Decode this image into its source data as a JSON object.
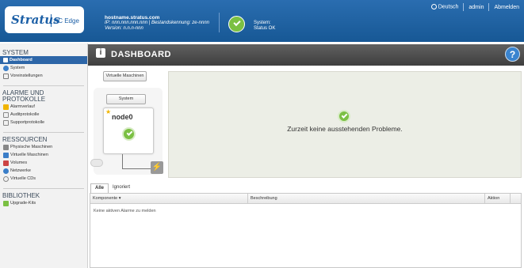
{
  "header": {
    "brand": "Stratus",
    "product": "ztC Edge",
    "hostname": "hostname.stratus.com",
    "ip_line": "IP: nnn.nnn.nnn.nnn | Bestandskennung: ze-nnnn",
    "version_line": "Version: n.n.n-nnn",
    "system_label": "System:",
    "system_status": "Status OK",
    "nav": {
      "language": "Deutsch",
      "user": "admin",
      "logout": "Abmelden"
    },
    "colors": {
      "accent": "#1c5fa3",
      "ok": "#7bc043"
    }
  },
  "sidebar": {
    "sections": [
      {
        "title": "SYSTEM",
        "items": [
          {
            "label": "Dashboard",
            "icon": "dashboard-icon",
            "active": true
          },
          {
            "label": "System",
            "icon": "system-icon"
          },
          {
            "label": "Voreinstellungen",
            "icon": "preferences-icon"
          }
        ]
      },
      {
        "title": "ALARME UND PROTOKOLLE",
        "items": [
          {
            "label": "Alarmverlauf",
            "icon": "alarm-icon"
          },
          {
            "label": "Auditprotokolle",
            "icon": "audit-log-icon"
          },
          {
            "label": "Supportprotokolle",
            "icon": "support-log-icon"
          }
        ]
      },
      {
        "title": "RESSOURCEN",
        "items": [
          {
            "label": "Physische Maschinen",
            "icon": "physical-machine-icon"
          },
          {
            "label": "Virtuelle Maschinen",
            "icon": "virtual-machine-icon"
          },
          {
            "label": "Volumes",
            "icon": "volume-icon"
          },
          {
            "label": "Netzwerke",
            "icon": "network-icon"
          },
          {
            "label": "Virtuelle CDs",
            "icon": "cd-icon"
          }
        ]
      },
      {
        "title": "BIBLIOTHEK",
        "items": [
          {
            "label": "Upgrade-Kits",
            "icon": "upgrade-kit-icon"
          }
        ]
      }
    ]
  },
  "page": {
    "title": "DASHBOARD",
    "diagram": {
      "vm_button": "Virtuelle Maschinen",
      "system_button": "System",
      "node_name": "node0"
    },
    "message": "Zurzeit keine ausstehenden Probleme.",
    "tabs": [
      "Alle",
      "Ignoriert"
    ],
    "table": {
      "columns": [
        "Komponente ▾",
        "Beschreibung",
        "Aktion"
      ],
      "empty_text": "Keine aktiven Alarme zu melden"
    }
  }
}
